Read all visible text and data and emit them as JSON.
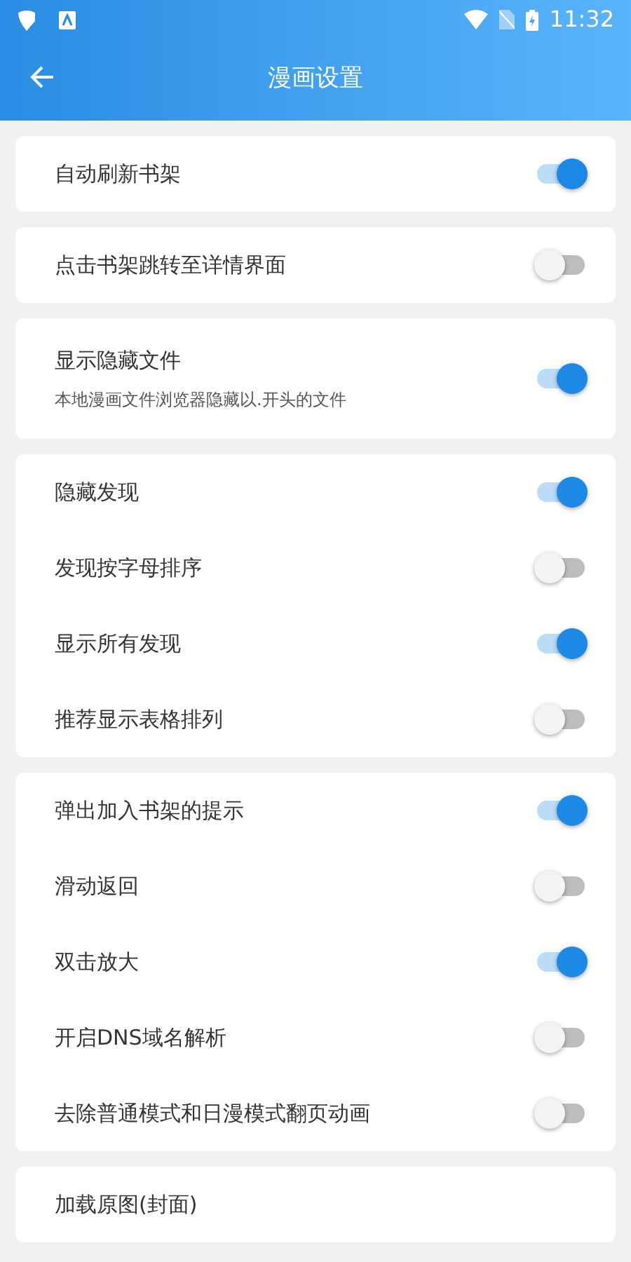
{
  "status_bar": {
    "time": "11:32"
  },
  "app_bar": {
    "title": "漫画设置"
  },
  "groups": [
    {
      "items": [
        {
          "label": "自动刷新书架",
          "on": true
        }
      ]
    },
    {
      "items": [
        {
          "label": "点击书架跳转至详情界面",
          "on": false
        }
      ]
    },
    {
      "items": [
        {
          "label": "显示隐藏文件",
          "description": "本地漫画文件浏览器隐藏以.开头的文件",
          "on": true
        }
      ]
    },
    {
      "items": [
        {
          "label": "隐藏发现",
          "on": true
        },
        {
          "label": "发现按字母排序",
          "on": false
        },
        {
          "label": "显示所有发现",
          "on": true
        },
        {
          "label": "推荐显示表格排列",
          "on": false
        }
      ]
    },
    {
      "items": [
        {
          "label": "弹出加入书架的提示",
          "on": true
        },
        {
          "label": "滑动返回",
          "on": false
        },
        {
          "label": "双击放大",
          "on": true
        },
        {
          "label": "开启DNS域名解析",
          "on": false
        },
        {
          "label": "去除普通模式和日漫模式翻页动画",
          "on": false
        }
      ]
    },
    {
      "items": [
        {
          "label": "加载原图(封面)"
        }
      ]
    }
  ]
}
